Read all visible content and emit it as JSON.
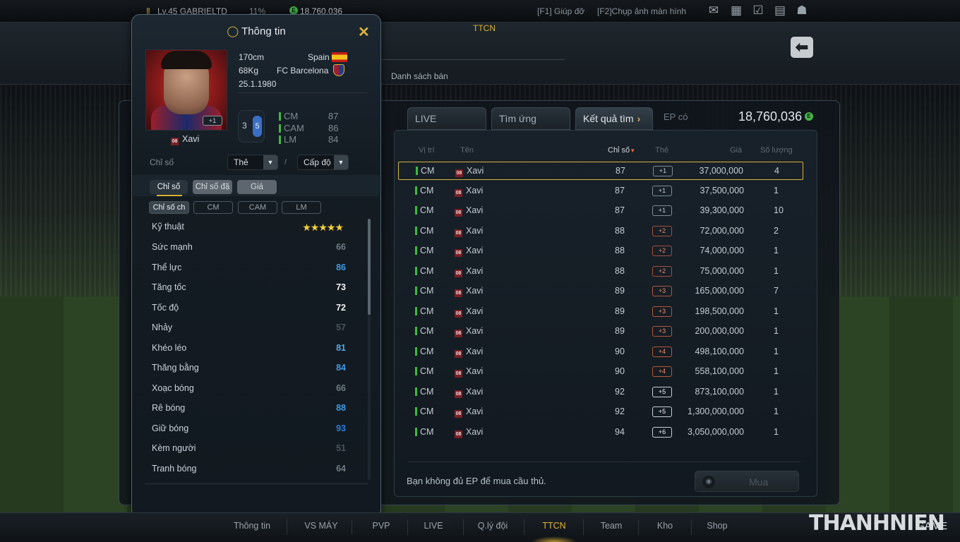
{
  "topbar": {
    "level_text": "Lv.45 GABRIELTD",
    "percent": "11%",
    "ep_balance": "18,760,036",
    "help": "[F1] Giúp đỡ",
    "screenshot": "[F2]Chụp ảnh màn hình"
  },
  "subbar": {
    "section": "TTCN",
    "sub_label": "Danh sách bán"
  },
  "tabs": {
    "live_boost": "LIVE BOOST",
    "candidates": "Tìm ứng viên",
    "results": "Kết quả tìm",
    "ep_label": "EP có",
    "ep_value": "18,760,036"
  },
  "columns": {
    "position": "Vị trí",
    "name": "Tên",
    "rating": "Chỉ số",
    "card": "Thẻ",
    "price": "Giá",
    "quantity": "Số lượng"
  },
  "rows": [
    {
      "pos": "CM",
      "name": "Xavi",
      "rating": "87",
      "card": "+1",
      "level": 1,
      "price": "37,000,000",
      "qty": "4",
      "selected": true
    },
    {
      "pos": "CM",
      "name": "Xavi",
      "rating": "87",
      "card": "+1",
      "level": 1,
      "price": "37,500,000",
      "qty": "1"
    },
    {
      "pos": "CM",
      "name": "Xavi",
      "rating": "87",
      "card": "+1",
      "level": 1,
      "price": "39,300,000",
      "qty": "10"
    },
    {
      "pos": "CM",
      "name": "Xavi",
      "rating": "88",
      "card": "+2",
      "level": 2,
      "price": "72,000,000",
      "qty": "2"
    },
    {
      "pos": "CM",
      "name": "Xavi",
      "rating": "88",
      "card": "+2",
      "level": 2,
      "price": "74,000,000",
      "qty": "1"
    },
    {
      "pos": "CM",
      "name": "Xavi",
      "rating": "88",
      "card": "+2",
      "level": 2,
      "price": "75,000,000",
      "qty": "1"
    },
    {
      "pos": "CM",
      "name": "Xavi",
      "rating": "89",
      "card": "+3",
      "level": 3,
      "price": "165,000,000",
      "qty": "7"
    },
    {
      "pos": "CM",
      "name": "Xavi",
      "rating": "89",
      "card": "+3",
      "level": 3,
      "price": "198,500,000",
      "qty": "1"
    },
    {
      "pos": "CM",
      "name": "Xavi",
      "rating": "89",
      "card": "+3",
      "level": 3,
      "price": "200,000,000",
      "qty": "1"
    },
    {
      "pos": "CM",
      "name": "Xavi",
      "rating": "90",
      "card": "+4",
      "level": 4,
      "price": "498,100,000",
      "qty": "1"
    },
    {
      "pos": "CM",
      "name": "Xavi",
      "rating": "90",
      "card": "+4",
      "level": 4,
      "price": "558,100,000",
      "qty": "1"
    },
    {
      "pos": "CM",
      "name": "Xavi",
      "rating": "92",
      "card": "+5",
      "level": 5,
      "price": "873,100,000",
      "qty": "1"
    },
    {
      "pos": "CM",
      "name": "Xavi",
      "rating": "92",
      "card": "+5",
      "level": 5,
      "price": "1,300,000,000",
      "qty": "1"
    },
    {
      "pos": "CM",
      "name": "Xavi",
      "rating": "94",
      "card": "+6",
      "level": 5,
      "price": "3,050,000,000",
      "qty": "1"
    }
  ],
  "footer": {
    "message": "Bạn không đủ EP để mua cầu thủ.",
    "buy": "Mua"
  },
  "info": {
    "title": "Thông tin",
    "height": "170cm",
    "weight": "68Kg",
    "birth": "25.1.1980",
    "country": "Spain",
    "club": "FC Barcelona",
    "name": "Xavi",
    "season_tag": "08",
    "card": "+1",
    "boot_left": "3",
    "boot_right": "5",
    "positions": [
      {
        "pos": "CM",
        "val": "87"
      },
      {
        "pos": "CAM",
        "val": "86"
      },
      {
        "pos": "LM",
        "val": "84"
      }
    ],
    "stat_label": "Chỉ số",
    "dropdown1": "Thẻ",
    "dropdown_sep": "/",
    "dropdown2": "Cấp độ",
    "pill_tabs": [
      "Chỉ số",
      "Chỉ số đặ",
      "Giá"
    ],
    "chips": [
      "Chỉ số ch",
      "CM",
      "CAM",
      "LM"
    ],
    "skill_label": "Kỹ thuật",
    "skill_stars": "★★★★★",
    "stats": [
      {
        "name": "Sức mạnh",
        "val": "66",
        "tone": "v-grey"
      },
      {
        "name": "Thể lực",
        "val": "86",
        "tone": "v-blue"
      },
      {
        "name": "Tăng tốc",
        "val": "73",
        "tone": "v-white"
      },
      {
        "name": "Tốc độ",
        "val": "72",
        "tone": "v-white"
      },
      {
        "name": "Nhảy",
        "val": "57",
        "tone": "v-dgrey"
      },
      {
        "name": "Khéo léo",
        "val": "81",
        "tone": "v-lblue"
      },
      {
        "name": "Thăng bằng",
        "val": "84",
        "tone": "v-blue"
      },
      {
        "name": "Xoạc bóng",
        "val": "66",
        "tone": "v-grey"
      },
      {
        "name": "Rê bóng",
        "val": "88",
        "tone": "v-blue"
      },
      {
        "name": "Giữ bóng",
        "val": "93",
        "tone": "v-dblue"
      },
      {
        "name": "Kèm người",
        "val": "51",
        "tone": "v-dgrey"
      },
      {
        "name": "Tranh bóng",
        "val": "64",
        "tone": "v-grey"
      }
    ]
  },
  "nav": [
    "Thông tin",
    "VS MÁY",
    "PVP",
    "LIVE",
    "Q.lý đội",
    "TTCN",
    "Team",
    "Kho",
    "Shop"
  ],
  "nav_active": "TTCN",
  "watermark": {
    "brand": "THANHNIEN",
    "suffix": "GAME"
  },
  "colors": {
    "accent_gold": "#d9b33a",
    "ep_green": "#43b649",
    "stat_blue": "#3e9be4"
  }
}
